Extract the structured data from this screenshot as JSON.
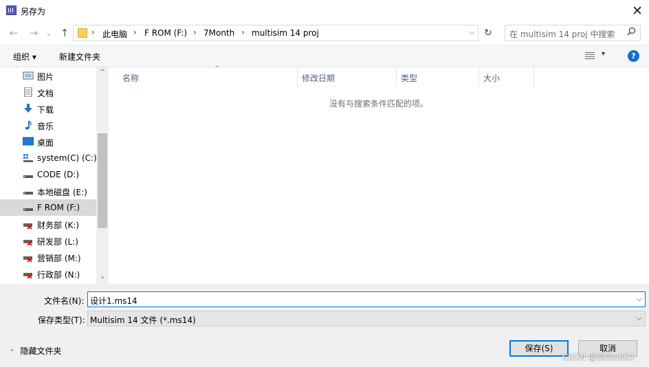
{
  "window": {
    "title": "另存为",
    "close_glyph": "✕"
  },
  "nav": {
    "back": "←",
    "forward": "→",
    "recent": "⌄",
    "up": "↑"
  },
  "address": {
    "crumbs": [
      "此电脑",
      "F ROM (F:)",
      "7Month",
      "multisim 14 proj"
    ],
    "separator": "›",
    "dropdown": "⌵",
    "refresh": "↻"
  },
  "search": {
    "placeholder": "在 multisim 14 proj 中搜索",
    "icon": "search-icon"
  },
  "toolbar": {
    "organize": "组织 ▾",
    "new_folder": "新建文件夹",
    "view_dd": "▾",
    "help": "?"
  },
  "sidebar": {
    "items": [
      {
        "label": "图片",
        "icon": "pictures-icon"
      },
      {
        "label": "文档",
        "icon": "documents-icon"
      },
      {
        "label": "下载",
        "icon": "download-icon"
      },
      {
        "label": "音乐",
        "icon": "music-icon"
      },
      {
        "label": "桌面",
        "icon": "desktop-icon"
      },
      {
        "label": "system(C) (C:)",
        "icon": "system-drive-icon"
      },
      {
        "label": "CODE (D:)",
        "icon": "drive-icon"
      },
      {
        "label": "本地磁盘 (E:)",
        "icon": "drive-icon"
      },
      {
        "label": "F ROM (F:)",
        "icon": "drive-icon",
        "selected": true
      },
      {
        "label": "财务部 (K:)",
        "icon": "network-drive-disconnected-icon"
      },
      {
        "label": "研发部 (L:)",
        "icon": "network-drive-disconnected-icon"
      },
      {
        "label": "营销部 (M:)",
        "icon": "network-drive-disconnected-icon"
      },
      {
        "label": "行政部 (N:)",
        "icon": "network-drive-disconnected-icon"
      }
    ],
    "scroll_up": "^",
    "scroll_down": "⌄"
  },
  "filelist": {
    "columns": [
      "名称",
      "修改日期",
      "类型",
      "大小"
    ],
    "sort_caret": "^",
    "empty_message": "没有与搜索条件匹配的项。"
  },
  "form": {
    "filename_label": "文件名(N):",
    "filename_value": "设计1.ms14",
    "filetype_label": "保存类型(T):",
    "filetype_value": "Multisim 14 文件 (*.ms14)",
    "dropdown_glyph": "⌵"
  },
  "footer": {
    "hide_folders": "隐藏文件夹",
    "hide_chevron": "⌃",
    "save": "保存(S)",
    "cancel": "取消",
    "watermark": "CSDN @Skiko663"
  },
  "colors": {
    "accent": "#0078d7",
    "selected_bg": "#d9d9d9",
    "dialog_bg": "#f0f0f0"
  }
}
